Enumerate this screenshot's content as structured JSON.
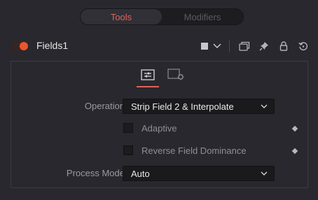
{
  "top_tabs": [
    {
      "label": "Tools",
      "active": true
    },
    {
      "label": "Modifiers",
      "active": false
    }
  ],
  "node": {
    "name": "Fields1",
    "enabled": true
  },
  "header_icons": [
    "color-square-icon",
    "chevron-down-icon",
    "versions-icon",
    "pin-icon",
    "lock-icon",
    "reset-icon"
  ],
  "control_tabs": [
    {
      "icon": "controls-sliders-icon",
      "active": true
    },
    {
      "icon": "settings-gear-icon",
      "active": false
    }
  ],
  "controls": {
    "operation": {
      "label": "Operation",
      "value": "Strip Field 2 & Interpolate"
    },
    "adaptive": {
      "label": "Adaptive",
      "checked": false
    },
    "reverse_field_dominance": {
      "label": "Reverse Field Dominance",
      "checked": false
    },
    "process_mode": {
      "label": "Process Mode",
      "value": "Auto"
    }
  },
  "colors": {
    "accent": "#e0625a",
    "toggle_on": "#e8552f",
    "background": "#28282e"
  }
}
